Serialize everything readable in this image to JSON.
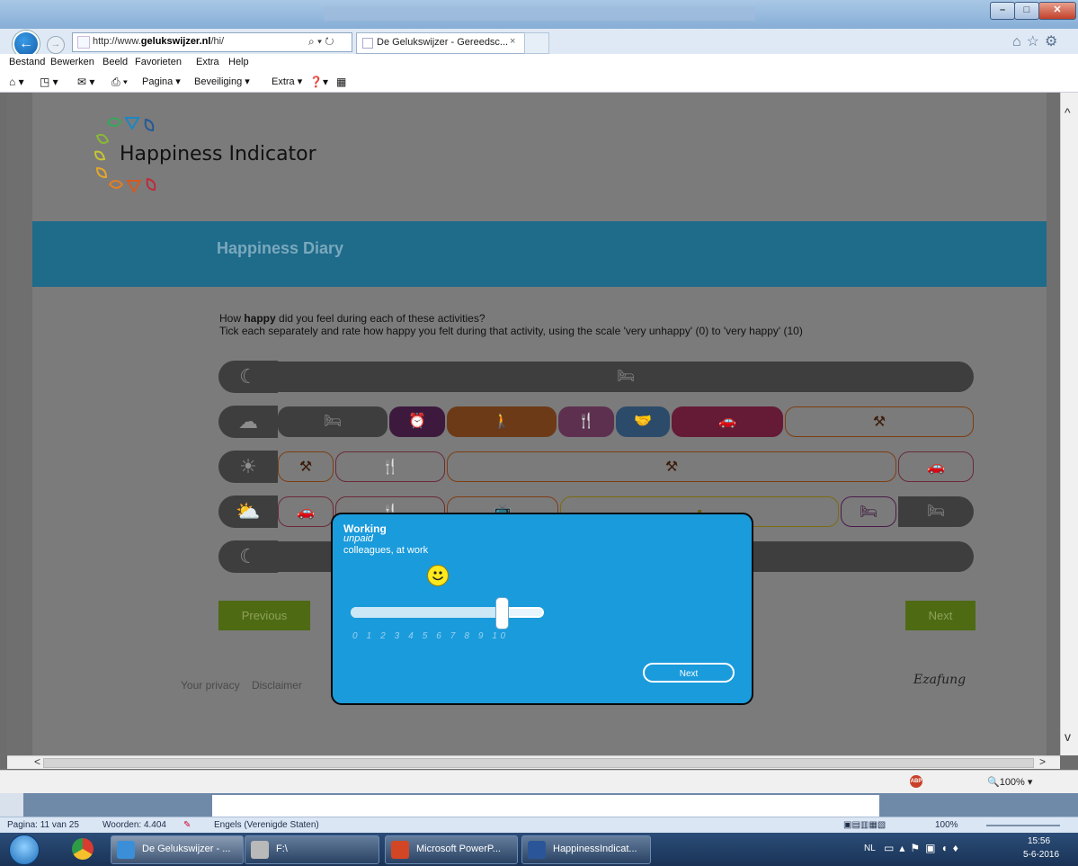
{
  "browser": {
    "address": "http://www.",
    "address_domain": "gelukswijzer.nl",
    "address_path": "/hi/",
    "address_icons": "⌕ ▾ ↻",
    "tab_title": "De Gelukswijzer - Gereedsc...",
    "tab_close": "×",
    "menu": [
      "Bestand",
      "Bewerken",
      "Beeld",
      "Favorieten",
      "Extra",
      "Help"
    ],
    "commands": [
      "Pagina ▾",
      "Beveiliging ▾",
      "Extra ▾"
    ],
    "zoom": "🔍100%  ▾",
    "abp": "ABP"
  },
  "page": {
    "logo_text": "Happiness Indicator",
    "band_title": "Happiness Diary",
    "question_pre": "How ",
    "question_bold": "happy",
    "question_post": " did you feel during each of these activities?",
    "question_line2": "Tick each separately and rate how happy you felt during that activity, using the scale 'very unhappy' (0) to 'very happy' (10)",
    "previous_label": "Previous",
    "next_label": "Next",
    "footer_privacy": "Your privacy",
    "footer_disclaimer": "Disclaimer",
    "erasmus": "Ezafung"
  },
  "modal": {
    "title": "Working",
    "subtitle": "unpaid",
    "company": "colleagues, at work",
    "scale": "0 1 2 3 4 5 6 7 8 9 10",
    "rating": 8,
    "next_label": "Next"
  },
  "word": {
    "page_info": "Pagina: 11 van 25",
    "words": "Woorden: 4.404",
    "language": "Engels (Verenigde Staten)",
    "zoom": "100%"
  },
  "taskbar": {
    "items": [
      "De Gelukswijzer - ...",
      "F:\\",
      "Microsoft PowerP...",
      "HappinessIndicat..."
    ],
    "lang": "NL",
    "time": "15:56",
    "date": "5-6-2016"
  }
}
